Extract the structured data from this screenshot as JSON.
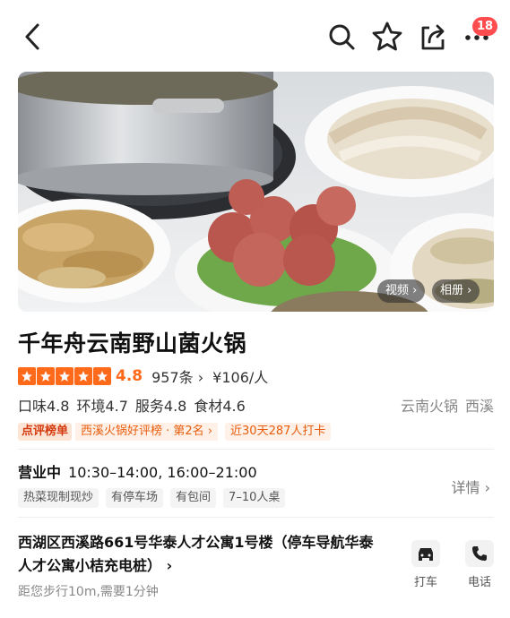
{
  "topbar": {
    "notification_count": "18",
    "icons": [
      "back-icon",
      "search-icon",
      "star-icon",
      "share-icon",
      "more-icon"
    ]
  },
  "hero": {
    "video_label": "视频",
    "album_label": "相册"
  },
  "restaurant": {
    "name": "千年舟云南野山菌火锅",
    "stars": 5,
    "score": "4.8",
    "review_count": "957条",
    "price": "¥106/人",
    "sub_scores": [
      {
        "label": "口味4.8"
      },
      {
        "label": "环境4.7"
      },
      {
        "label": "服务4.8"
      },
      {
        "label": "食材4.6"
      }
    ],
    "category": "云南火锅",
    "area": "西溪",
    "rank_tag": "点评榜单",
    "rank_text": "西溪火锅好评榜 · 第2名",
    "checkin_text": "近30天287人打卡"
  },
  "hours": {
    "status": "营业中",
    "time": "10:30–14:00, 16:00–21:00",
    "details_label": "详情"
  },
  "facility_tags": [
    "热菜现制现炒",
    "有停车场",
    "有包间",
    "7–10人桌"
  ],
  "address": {
    "text": "西湖区西溪路661号华泰人才公寓1号楼（停车导航华泰人才公寓小桔充电桩）",
    "distance": "距您步行10m,需要1分钟"
  },
  "actions": {
    "taxi_label": "打车",
    "phone_label": "电话"
  },
  "colors": {
    "accent": "#ff6a1a",
    "badge": "#ff4d4f",
    "rank_text": "#e85d0c"
  }
}
